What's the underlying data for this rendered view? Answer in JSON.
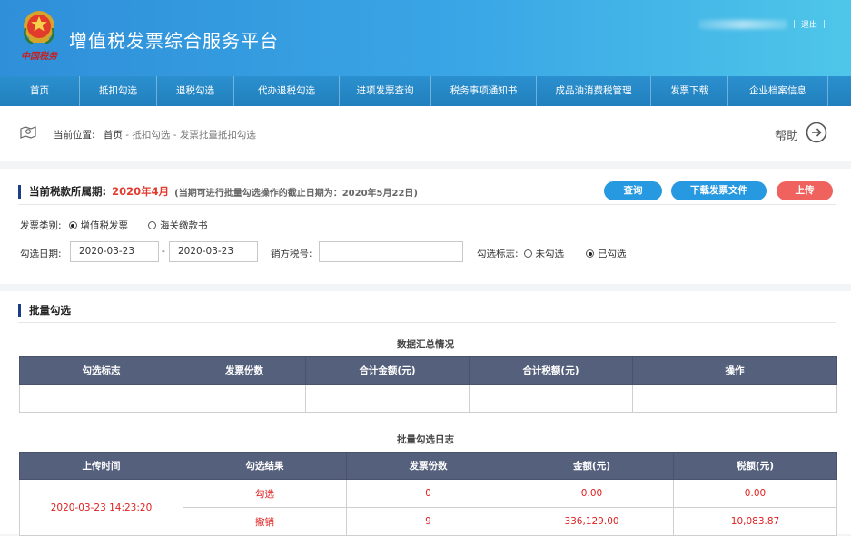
{
  "app": {
    "title": "增值税发票综合服务平台",
    "logo_text": "中国税务",
    "user_name": "██████████",
    "logout": "退出",
    "divider": "|"
  },
  "nav": [
    "首页",
    "抵扣勾选",
    "退税勾选",
    "代办退税勾选",
    "进项发票查询",
    "税务事项通知书",
    "成品油消费税管理",
    "发票下载",
    "企业档案信息"
  ],
  "breadcrumb": {
    "label": "当前位置:",
    "home": "首页",
    "sep": "-",
    "level1": "抵扣勾选",
    "level2": "发票批量抵扣勾选"
  },
  "help_label": "帮助",
  "tax_period": {
    "label": "当前税款所属期:",
    "value": "2020年4月",
    "note": "(当期可进行批量勾选操作的截止日期为：2020年5月22日)"
  },
  "buttons": {
    "query": "查询",
    "download": "下载发票文件",
    "upload": "上传"
  },
  "form": {
    "invoice_type_label": "发票类别:",
    "invoice_type_options": [
      "增值税发票",
      "海关缴款书"
    ],
    "invoice_type_selected": 0,
    "date_label": "勾选日期:",
    "date_from": "2020-03-23",
    "date_to": "2020-03-23",
    "date_sep": "-",
    "seller_tax_label": "销方税号:",
    "seller_tax_value": "",
    "check_flag_label": "勾选标志:",
    "check_flag_options": [
      "未勾选",
      "已勾选"
    ],
    "check_flag_selected": 1
  },
  "batch": {
    "title": "批量勾选",
    "summary_caption": "数据汇总情况",
    "summary_headers": [
      "勾选标志",
      "发票份数",
      "合计金额(元)",
      "合计税额(元)",
      "操作"
    ],
    "log_caption": "批量勾选日志",
    "log_headers": [
      "上传时间",
      "勾选结果",
      "发票份数",
      "金额(元)",
      "税额(元)"
    ],
    "log_time": "2020-03-23 14:23:20",
    "log_rows": [
      {
        "result": "勾选",
        "count": "0",
        "amount": "0.00",
        "tax": "0.00"
      },
      {
        "result": "撤销",
        "count": "9",
        "amount": "336,129.00",
        "tax": "10,083.87"
      }
    ]
  },
  "colors": {
    "header_start": "#2f8fd9",
    "header_end": "#4ec6e9",
    "nav": "#2285c5",
    "table_head": "#55607c",
    "accent_red": "#e23b2e",
    "btn_blue": "#2699e0",
    "btn_red": "#f0625d"
  }
}
